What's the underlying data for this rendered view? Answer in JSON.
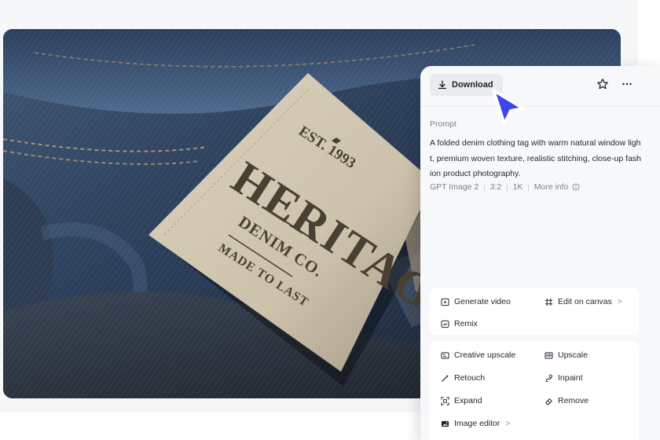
{
  "image": {
    "subject": "denim-clothing-tag",
    "tag_lines": [
      "EST. 1993",
      "HERITAGE",
      "DENIM CO.",
      "MADE TO LAST"
    ]
  },
  "panel": {
    "download_label": "Download",
    "prompt_label": "Prompt",
    "prompt_text": "A folded denim clothing tag with warm natural window light, premium woven texture, realistic stitching, close-up fashion product photography.",
    "meta": {
      "model": "GPT Image 2",
      "ratio": "3:2",
      "resolution": "1K",
      "more_info": "More info"
    },
    "actions_primary": {
      "generate_video": "Generate video",
      "edit_on_canvas": "Edit on canvas",
      "remix": "Remix"
    },
    "actions_tools": {
      "creative_upscale": "Creative upscale",
      "upscale": "Upscale",
      "retouch": "Retouch",
      "inpaint": "Inpaint",
      "expand": "Expand",
      "remove": "Remove",
      "image_editor": "Image editor"
    }
  },
  "colors": {
    "cursor": "#3d46e8",
    "panel_bg": "#f7f8fa",
    "card_bg": "#ffffff",
    "tag_ink": "#4a3f33",
    "tag_fabric": "#d2c7b3"
  },
  "icons": [
    "download-icon",
    "star-icon",
    "more-icon",
    "info-icon",
    "play-icon",
    "crop-icon",
    "remix-icon",
    "hd-icon",
    "upscale-icon",
    "wand-icon",
    "inpaint-icon",
    "expand-icon",
    "eraser-icon",
    "image-editor-icon",
    "cursor-pointer-icon"
  ]
}
